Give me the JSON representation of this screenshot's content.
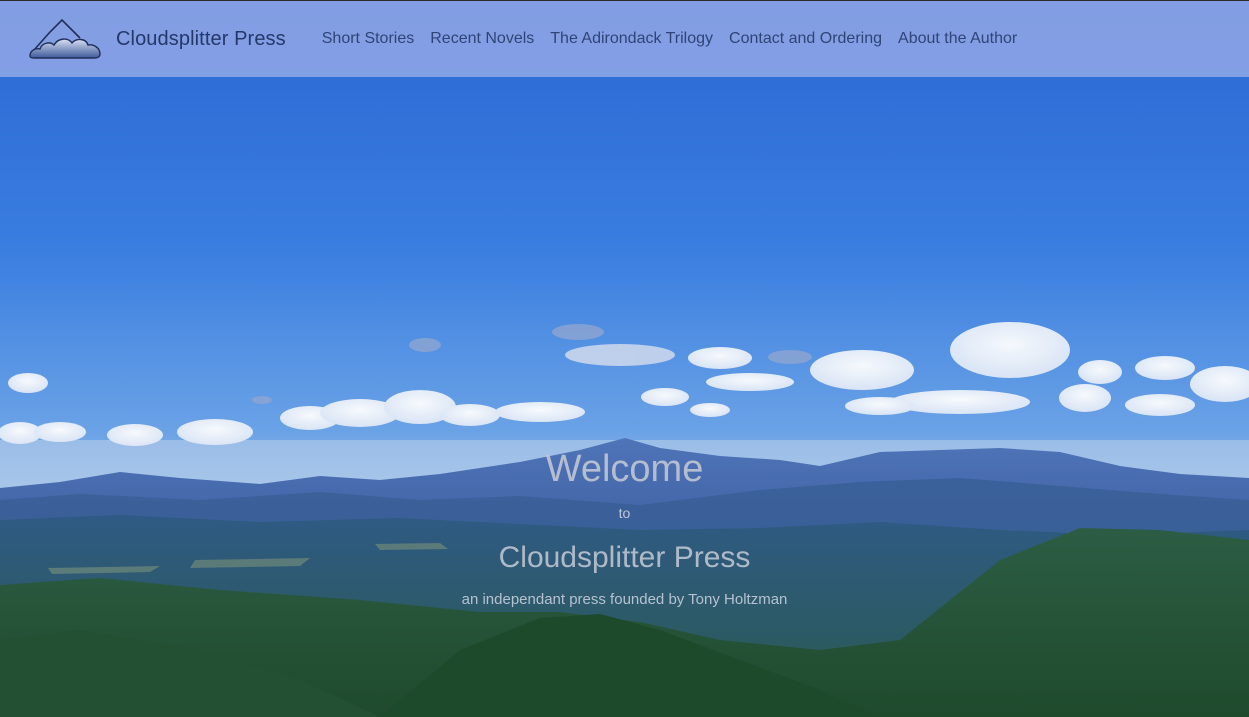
{
  "brand": {
    "name": "Cloudsplitter Press",
    "logo_icon": "mountain-cloud-logo-icon"
  },
  "nav": {
    "items": [
      {
        "label": "Short Stories"
      },
      {
        "label": "Recent Novels"
      },
      {
        "label": "The Adirondack Trilogy"
      },
      {
        "label": "Contact and Ordering"
      },
      {
        "label": "About the Author"
      }
    ]
  },
  "hero": {
    "welcome": "Welcome",
    "to": "to",
    "press_name": "Cloudsplitter Press",
    "tagline": "an independant press founded by Tony Holtzman"
  },
  "colors": {
    "navbar_bg": "#96aae6",
    "nav_text": "#2f4478",
    "sky_top": "#2d6fd8",
    "sky_horizon": "#9cc2ec"
  }
}
